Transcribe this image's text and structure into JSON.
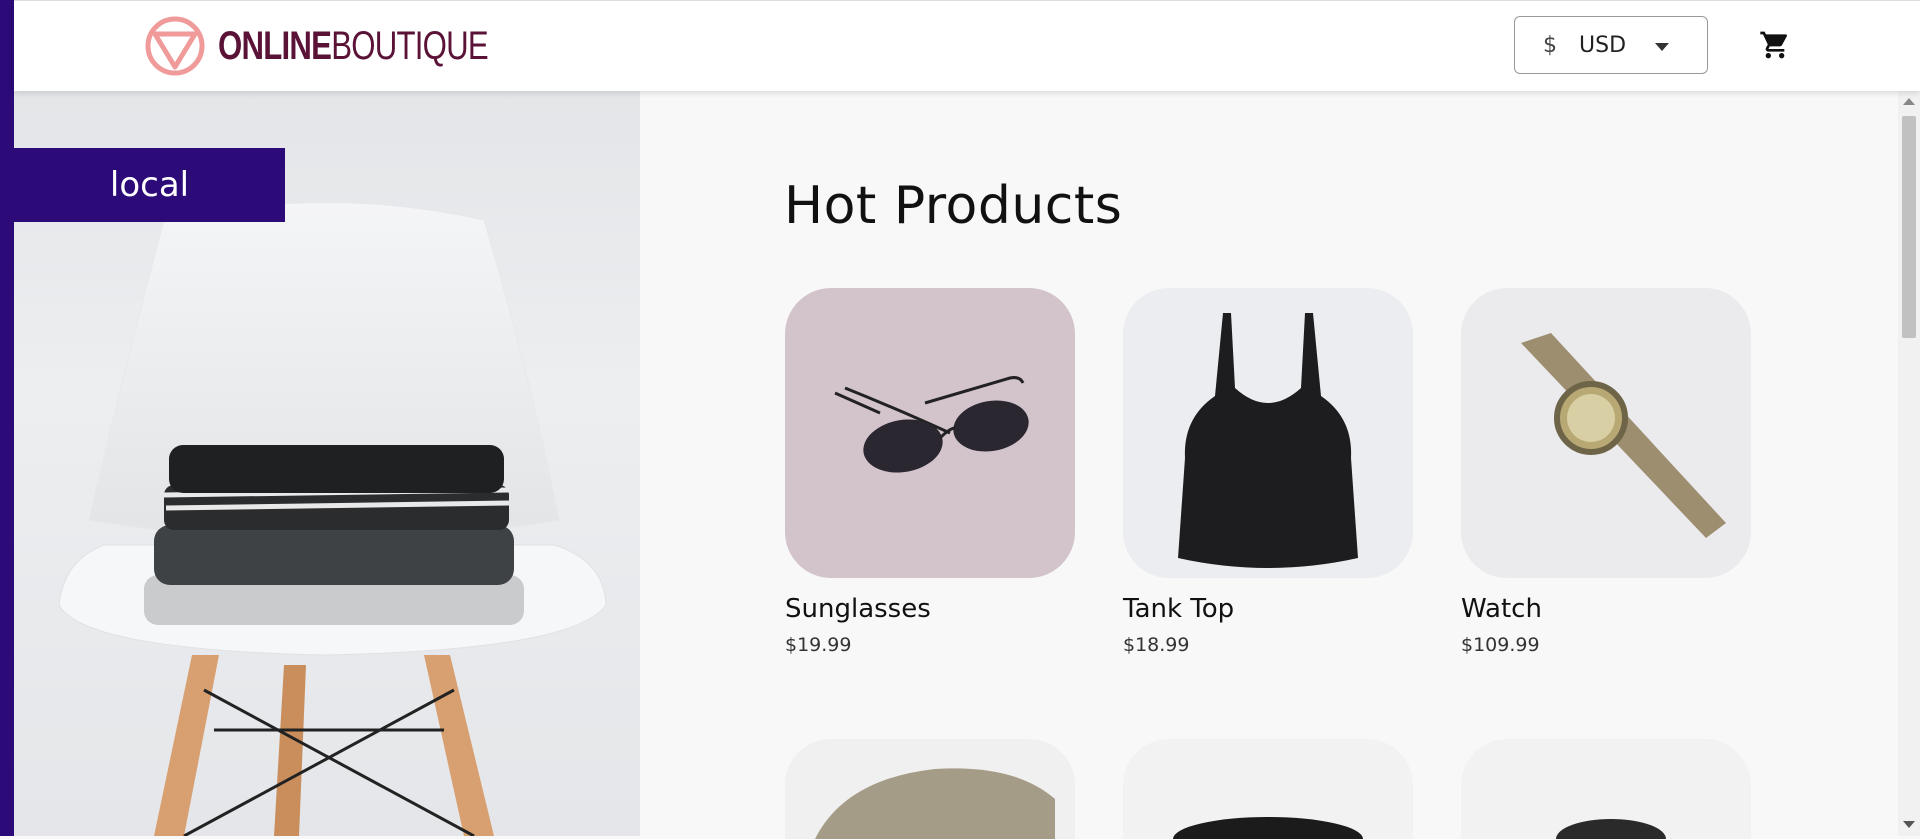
{
  "colors": {
    "brand_dark": "#5a1237",
    "brand_pink": "#f09a9a",
    "env_badge_bg": "#2c0a78",
    "page_bg": "#f8f8f9"
  },
  "header": {
    "logo": {
      "part1": "ONLINE",
      "part2": "BOUTIQUE",
      "icon": "boutique-triangle-logo-icon"
    },
    "currency": {
      "symbol": "$",
      "code": "USD",
      "icon": "caret-down-icon"
    },
    "cart_icon": "shopping-cart-icon"
  },
  "environment_badge": "local",
  "section_title": "Hot Products",
  "products": [
    {
      "name": "Sunglasses",
      "price": "$19.99",
      "image": "sunglasses"
    },
    {
      "name": "Tank Top",
      "price": "$18.99",
      "image": "tank-top"
    },
    {
      "name": "Watch",
      "price": "$109.99",
      "image": "watch"
    }
  ],
  "products_row2": [
    {
      "image": "loafers"
    },
    {
      "image": "hairdryer"
    },
    {
      "image": "candle-holder"
    }
  ]
}
